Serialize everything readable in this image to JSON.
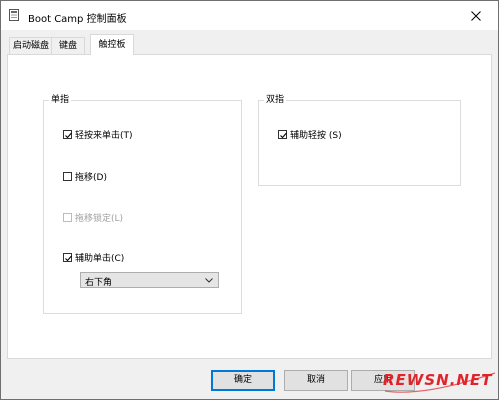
{
  "window": {
    "title": "Boot Camp 控制面板"
  },
  "tabs": [
    {
      "label": "启动磁盘",
      "active": false
    },
    {
      "label": "键盘",
      "active": false
    },
    {
      "label": "触控板",
      "active": true
    }
  ],
  "single_finger": {
    "title": "单指",
    "tap_to_click": {
      "label": "轻按来单击(T)",
      "checked": true
    },
    "dragging": {
      "label": "拖移(D)",
      "checked": false
    },
    "drag_lock": {
      "label": "拖移锁定(L)",
      "checked": false,
      "enabled": false
    },
    "secondary_click": {
      "label": "辅助单击(C)",
      "checked": true
    },
    "secondary_click_select": {
      "value": "右下角"
    }
  },
  "two_finger": {
    "title": "双指",
    "secondary_tap": {
      "label": "辅助轻按 (S)",
      "checked": true
    }
  },
  "buttons": {
    "ok": "确定",
    "cancel": "取消",
    "apply": "应用"
  },
  "watermark": {
    "text": "REWSN.NET"
  },
  "colors": {
    "accent": "#0078d7",
    "watermark": "#e0242b"
  }
}
